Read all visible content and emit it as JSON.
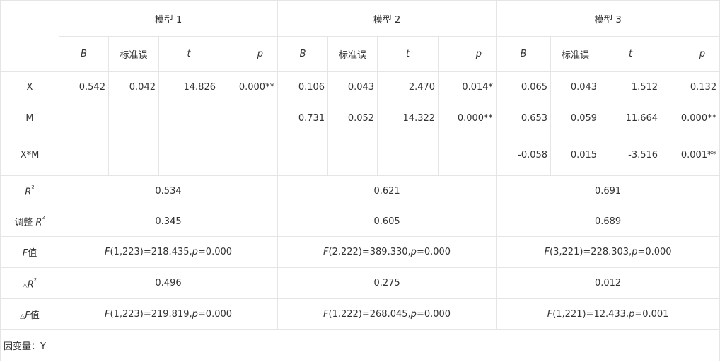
{
  "models": [
    {
      "title": "模型 1"
    },
    {
      "title": "模型 2"
    },
    {
      "title": "模型 3"
    }
  ],
  "columns": {
    "b": "B",
    "se": "标准误",
    "t": "t",
    "p": "p"
  },
  "rows": {
    "x": {
      "label": "X",
      "m1": [
        "0.542",
        "0.042",
        "14.826",
        "0.000**"
      ],
      "m2": [
        "0.106",
        "0.043",
        "2.470",
        "0.014*"
      ],
      "m3": [
        "0.065",
        "0.043",
        "1.512",
        "0.132"
      ]
    },
    "m": {
      "label": "M",
      "m2": [
        "0.731",
        "0.052",
        "14.322",
        "0.000**"
      ],
      "m3": [
        "0.653",
        "0.059",
        "11.664",
        "0.000**"
      ]
    },
    "xm": {
      "label": "X*M",
      "m3": [
        "-0.058",
        "0.015",
        "-3.516",
        "0.001**"
      ]
    }
  },
  "summary": {
    "r2": {
      "label_sym": "R",
      "label_sup": "²",
      "values": [
        "0.534",
        "0.621",
        "0.691"
      ]
    },
    "adj_r2": {
      "label_prefix": "调整 ",
      "label_sym": "R",
      "label_sup": "²",
      "values": [
        "0.345",
        "0.605",
        "0.689"
      ]
    },
    "f": {
      "label_sym": "F",
      "label_suffix": "值",
      "values": [
        {
          "f_sym": "F",
          "args": "(1,223)=218.435,",
          "p_sym": "p",
          "p_val": "=0.000"
        },
        {
          "f_sym": "F",
          "args": "(2,222)=389.330,",
          "p_sym": "p",
          "p_val": "=0.000"
        },
        {
          "f_sym": "F",
          "args": "(3,221)=228.303,",
          "p_sym": "p",
          "p_val": "=0.000"
        }
      ]
    },
    "delta_r2": {
      "label_prefix": "△",
      "label_sym": "R",
      "label_sup": "²",
      "values": [
        "0.496",
        "0.275",
        "0.012"
      ]
    },
    "delta_f": {
      "label_prefix": "△",
      "label_sym": "F",
      "label_suffix": "值",
      "values": [
        {
          "f_sym": "F",
          "args": "(1,223)=219.819,",
          "p_sym": "p",
          "p_val": "=0.000"
        },
        {
          "f_sym": "F",
          "args": "(1,222)=268.045,",
          "p_sym": "p",
          "p_val": "=0.000"
        },
        {
          "f_sym": "F",
          "args": "(1,221)=12.433,",
          "p_sym": "p",
          "p_val": "=0.001"
        }
      ]
    }
  },
  "footnote": "因变量：Y"
}
